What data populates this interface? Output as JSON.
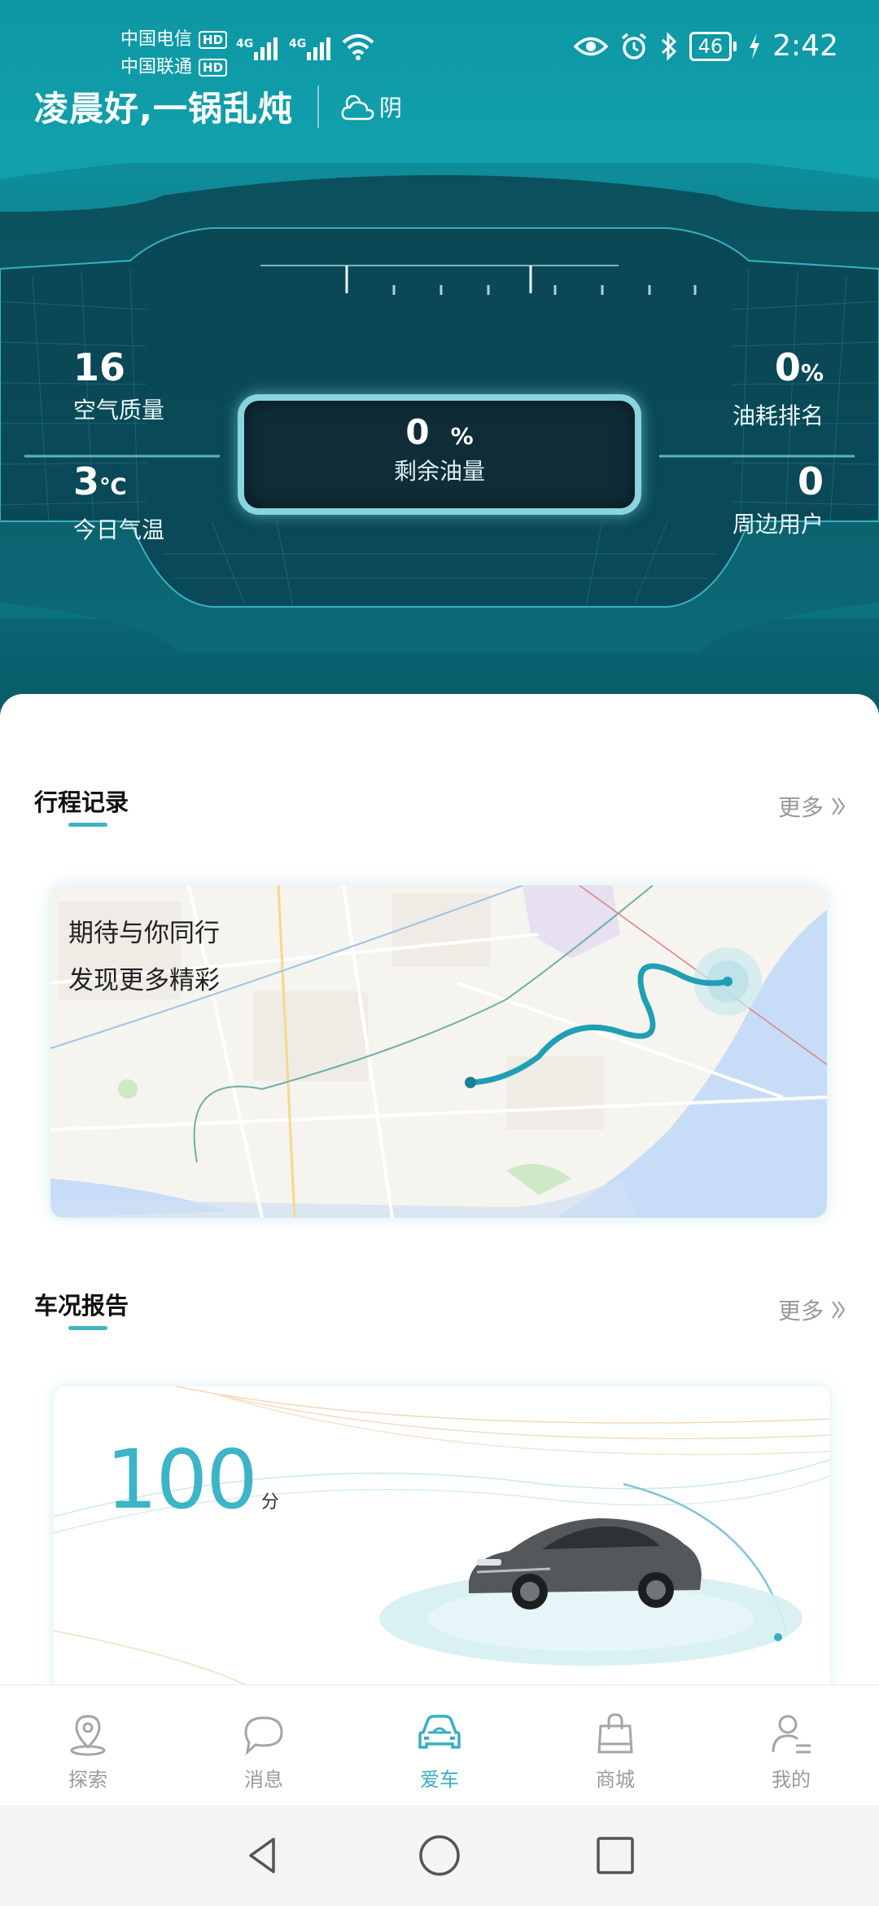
{
  "status_bar": {
    "carrier1": "中国电信",
    "carrier2": "中国联通",
    "hd": "HD",
    "net1": "4G",
    "net2": "4G",
    "battery": "46",
    "time": "2:42"
  },
  "greeting": {
    "text": "凌晨好,一锅乱炖",
    "weather": "阴"
  },
  "dashboard": {
    "air_quality": {
      "value": "16",
      "label": "空气质量"
    },
    "temperature": {
      "value": "3",
      "unit": "℃",
      "label": "今日气温"
    },
    "fuel": {
      "value": "0",
      "unit": "%",
      "label": "剩余油量"
    },
    "fuel_rank": {
      "value": "0",
      "unit": "%",
      "label": "油耗排名"
    },
    "nearby_users": {
      "value": "0",
      "label": "周边用户"
    }
  },
  "trip": {
    "title": "行程记录",
    "more": "更多",
    "line1": "期待与你同行",
    "line2": "发现更多精彩"
  },
  "report": {
    "title": "车况报告",
    "more": "更多",
    "score": "100",
    "score_unit": "分"
  },
  "tabs": [
    {
      "label": "探索",
      "icon": "location-pin-icon"
    },
    {
      "label": "消息",
      "icon": "chat-bubble-icon"
    },
    {
      "label": "爱车",
      "icon": "car-icon",
      "active": true
    },
    {
      "label": "商城",
      "icon": "shopping-bag-icon"
    },
    {
      "label": "我的",
      "icon": "profile-icon"
    }
  ],
  "colors": {
    "accent": "#3aaec2",
    "header_top": "#0d97a3",
    "header_bottom": "#0a5a67"
  }
}
